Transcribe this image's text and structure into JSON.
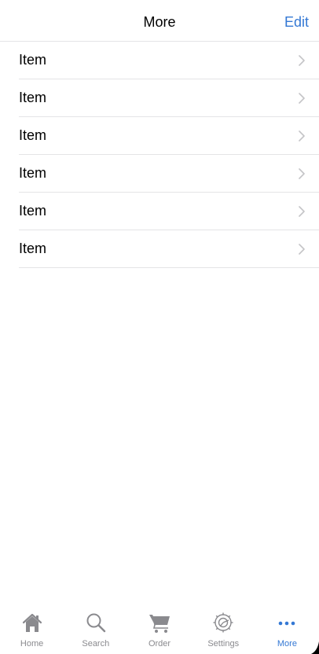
{
  "nav": {
    "title": "More",
    "edit_label": "Edit"
  },
  "list": {
    "items": [
      {
        "label": "Item"
      },
      {
        "label": "Item"
      },
      {
        "label": "Item"
      },
      {
        "label": "Item"
      },
      {
        "label": "Item"
      },
      {
        "label": "Item"
      }
    ]
  },
  "tabbar": {
    "tabs": [
      {
        "label": "Home",
        "icon": "house-icon"
      },
      {
        "label": "Search",
        "icon": "magnifier-icon"
      },
      {
        "label": "Order",
        "icon": "cart-icon"
      },
      {
        "label": "Settings",
        "icon": "gear-icon"
      },
      {
        "label": "More",
        "icon": "ellipsis-icon",
        "active": true
      }
    ]
  },
  "colors": {
    "accent": "#3478d4",
    "inactive": "#8a8a8e",
    "separator": "#e4e4e6"
  }
}
